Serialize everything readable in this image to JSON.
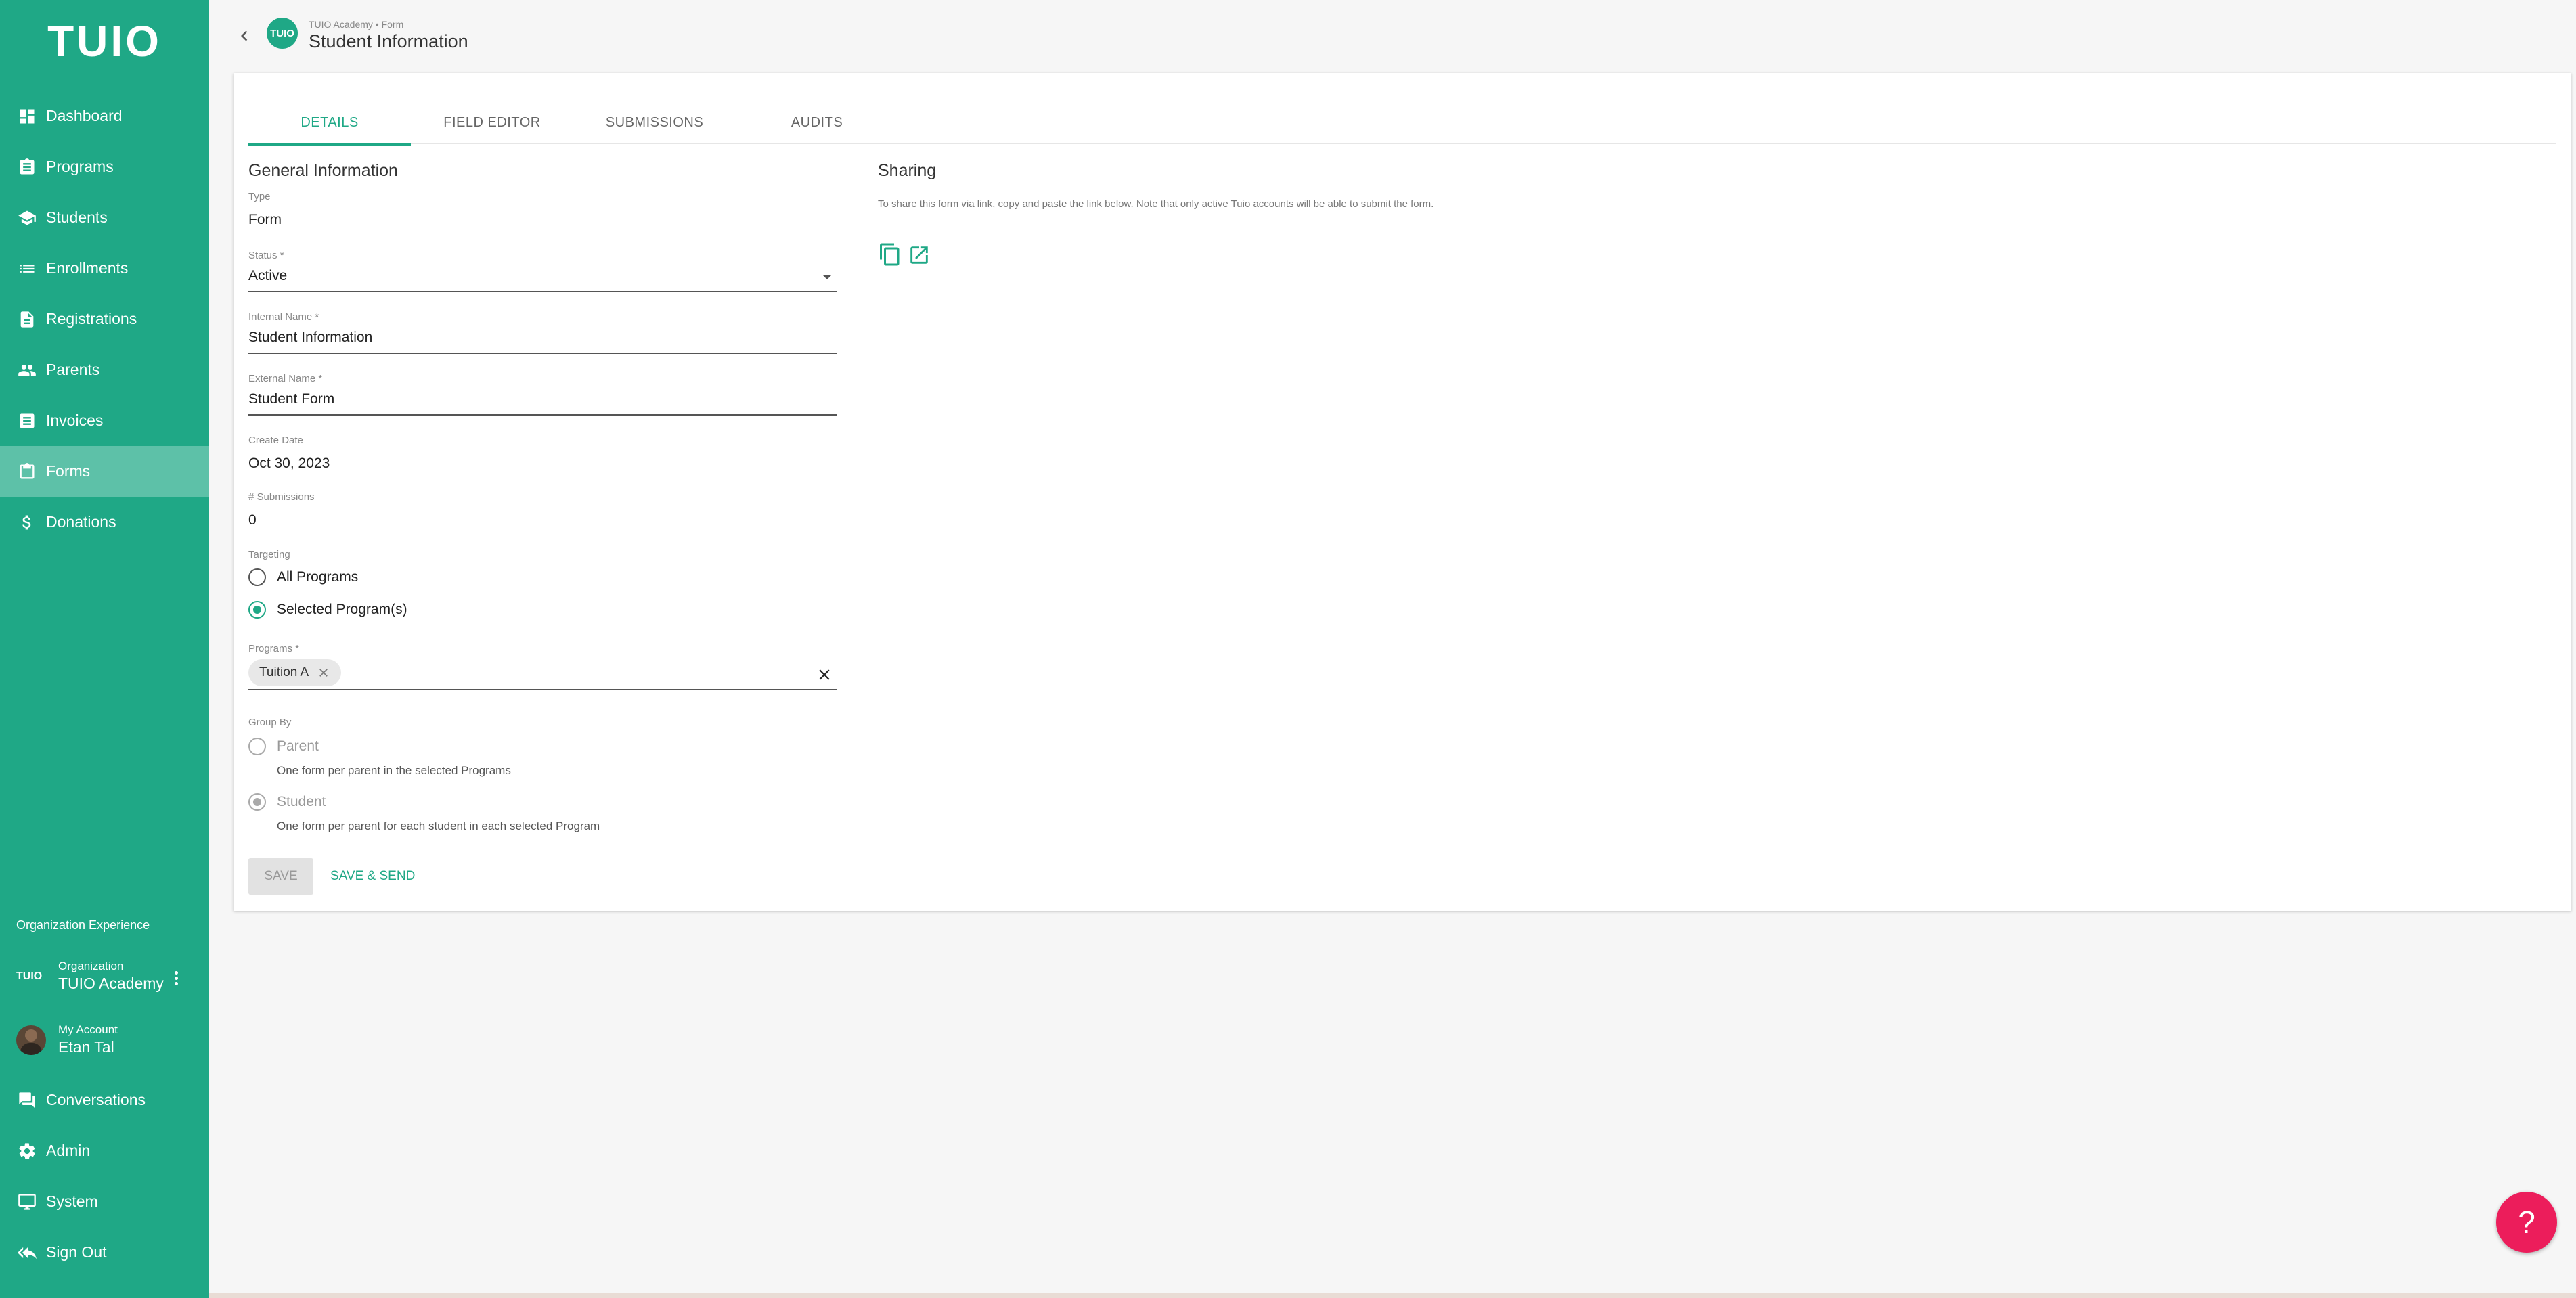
{
  "sidebar": {
    "logo": "TUIO",
    "items": [
      {
        "label": "Dashboard",
        "icon": "dashboard-icon"
      },
      {
        "label": "Programs",
        "icon": "clipboard-icon"
      },
      {
        "label": "Students",
        "icon": "school-icon"
      },
      {
        "label": "Enrollments",
        "icon": "list-icon"
      },
      {
        "label": "Registrations",
        "icon": "document-icon"
      },
      {
        "label": "Parents",
        "icon": "people-icon"
      },
      {
        "label": "Invoices",
        "icon": "receipt-icon"
      },
      {
        "label": "Forms",
        "icon": "form-icon",
        "active": true
      },
      {
        "label": "Donations",
        "icon": "dollar-icon"
      }
    ],
    "org_experience": "Organization Experience",
    "organization": {
      "caption": "Organization",
      "name": "TUIO Academy",
      "logo": "TUIO"
    },
    "account": {
      "caption": "My Account",
      "name": "Etan Tal"
    },
    "bottom_items": [
      {
        "label": "Conversations",
        "icon": "chat-icon"
      },
      {
        "label": "Admin",
        "icon": "gear-icon"
      },
      {
        "label": "System",
        "icon": "monitor-icon"
      },
      {
        "label": "Sign Out",
        "icon": "sign-out-icon"
      }
    ]
  },
  "header": {
    "avatar_text": "TUIO",
    "breadcrumb": "TUIO Academy • Form",
    "title": "Student Information"
  },
  "tabs": [
    "DETAILS",
    "FIELD EDITOR",
    "SUBMISSIONS",
    "AUDITS"
  ],
  "general": {
    "title": "General Information",
    "type_label": "Type",
    "type_value": "Form",
    "status_label": "Status *",
    "status_value": "Active",
    "internal_label": "Internal Name *",
    "internal_value": "Student Information",
    "external_label": "External Name *",
    "external_value": "Student Form",
    "create_label": "Create Date",
    "create_value": "Oct 30, 2023",
    "submissions_label": "# Submissions",
    "submissions_value": "0",
    "targeting_label": "Targeting",
    "targeting_options": [
      "All Programs",
      "Selected Program(s)"
    ],
    "targeting_selected": 1,
    "programs_label": "Programs *",
    "programs_chip": "Tuition A",
    "group_label": "Group By",
    "group_parent": "Parent",
    "group_parent_desc": "One form per parent in the selected Programs",
    "group_student": "Student",
    "group_student_desc": "One form per parent for each student in each selected Program",
    "save": "SAVE",
    "save_send": "SAVE & SEND"
  },
  "sharing": {
    "title": "Sharing",
    "desc": "To share this form via link, copy and paste the link below. Note that only active Tuio accounts will be able to submit the form."
  },
  "help": "?",
  "colors": {
    "brand": "#1fa886",
    "active_nav": "#5dc1a8",
    "help": "#ec1d5b"
  }
}
